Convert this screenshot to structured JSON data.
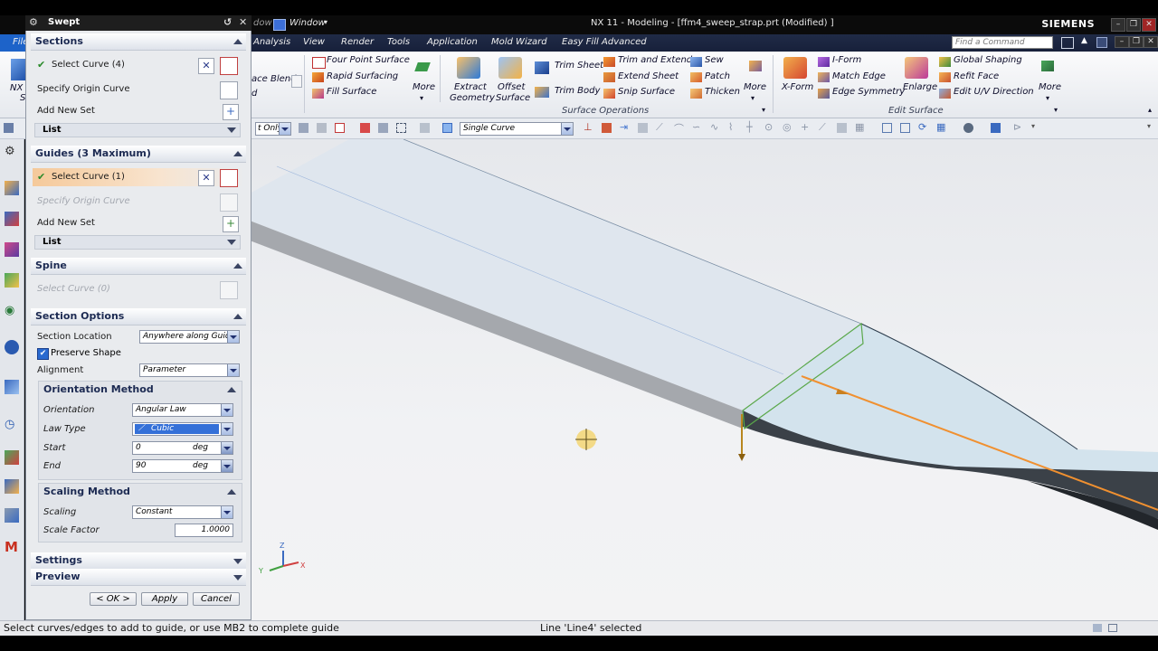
{
  "window": {
    "title": "NX 11 - Modeling - [ffm4_sweep_strap.prt (Modified) ]",
    "brand": "SIEMENS",
    "window_menu": "Window",
    "partial_left": "dow"
  },
  "menu": {
    "items": [
      "File",
      "Analysis",
      "View",
      "Render",
      "Tools",
      "Application",
      "Mold Wizard",
      "Easy Fill Advanced"
    ],
    "find_placeholder": "Find a Command"
  },
  "ribbon": {
    "left_partial": [
      "NX",
      "S",
      "ace Blend",
      "d"
    ],
    "col1": [
      "Four Point Surface",
      "Rapid Surfacing",
      "Fill Surface"
    ],
    "more1": "More",
    "extract_geometry": [
      "Extract",
      "Geometry"
    ],
    "offset_surface": [
      "Offset",
      "Surface"
    ],
    "trim_sheet": "Trim Sheet",
    "trim_body": "Trim Body",
    "col3": [
      "Trim and Extend",
      "Extend Sheet",
      "Snip Surface"
    ],
    "col4": [
      "Sew",
      "Patch",
      "Thicken"
    ],
    "more2": "More",
    "surface_operations": "Surface Operations",
    "x_form": "X-Form",
    "col5": [
      "I-Form",
      "Match Edge",
      "Edge Symmetry"
    ],
    "enlarge": "Enlarge",
    "col6": [
      "Global Shaping",
      "Refit Face",
      "Edit U/V Direction"
    ],
    "more3": "More",
    "edit_surface": "Edit Surface"
  },
  "toolbar": {
    "filter_partial": "t Only",
    "selection_filter": "Single Curve"
  },
  "dialog": {
    "title": "Swept",
    "sections": {
      "title": "Sections",
      "select_curve": "Select Curve (4)",
      "specify_origin": "Specify Origin Curve",
      "add_new_set": "Add New Set",
      "list": "List"
    },
    "guides": {
      "title": "Guides (3 Maximum)",
      "select_curve": "Select Curve (1)",
      "specify_origin": "Specify Origin Curve",
      "add_new_set": "Add New Set",
      "list": "List"
    },
    "spine": {
      "title": "Spine",
      "select_curve": "Select Curve (0)"
    },
    "section_options": {
      "title": "Section Options",
      "section_location_label": "Section Location",
      "section_location_value": "Anywhere along Guide",
      "preserve_shape": "Preserve Shape",
      "alignment_label": "Alignment",
      "alignment_value": "Parameter"
    },
    "orientation": {
      "title": "Orientation Method",
      "orientation_label": "Orientation",
      "orientation_value": "Angular Law",
      "law_type_label": "Law Type",
      "law_type_value": "Cubic",
      "start_label": "Start",
      "start_value": "0",
      "start_unit": "deg",
      "end_label": "End",
      "end_value": "90",
      "end_unit": "deg"
    },
    "scaling": {
      "title": "Scaling Method",
      "scaling_label": "Scaling",
      "scaling_value": "Constant",
      "scale_factor_label": "Scale Factor",
      "scale_factor_value": "1.0000"
    },
    "settings": "Settings",
    "preview": "Preview",
    "buttons": {
      "ok": "< OK >",
      "apply": "Apply",
      "cancel": "Cancel"
    }
  },
  "status": {
    "left": "Select curves/edges to add to guide, or use MB2 to complete guide",
    "middle": "Line 'Line4' selected"
  },
  "axes": {
    "x": "X",
    "y": "Y",
    "z": "Z"
  }
}
